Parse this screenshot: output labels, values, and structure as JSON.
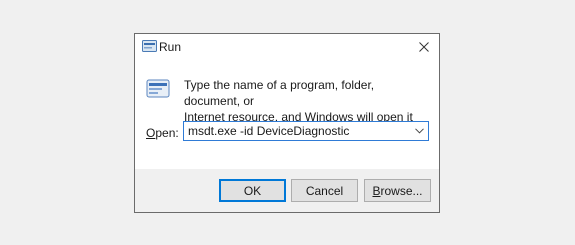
{
  "window": {
    "title": "Run",
    "icon": "run-app-icon",
    "close_icon": "close-icon"
  },
  "instruction": {
    "line1": "Type the name of a program, folder, document, or",
    "line2": "Internet resource, and Windows will open it for you."
  },
  "open_field": {
    "label_mnemonic": "O",
    "label_rest": "pen:",
    "value": "msdt.exe -id DeviceDiagnostic",
    "dropdown_icon": "chevron-down-icon"
  },
  "buttons": {
    "ok": "OK",
    "cancel": "Cancel",
    "browse_mnemonic": "B",
    "browse_rest": "rowse..."
  },
  "colors": {
    "focus_border": "#2f7bd6",
    "button_face": "#e1e1e1",
    "footer_bg": "#f0f0f0"
  }
}
